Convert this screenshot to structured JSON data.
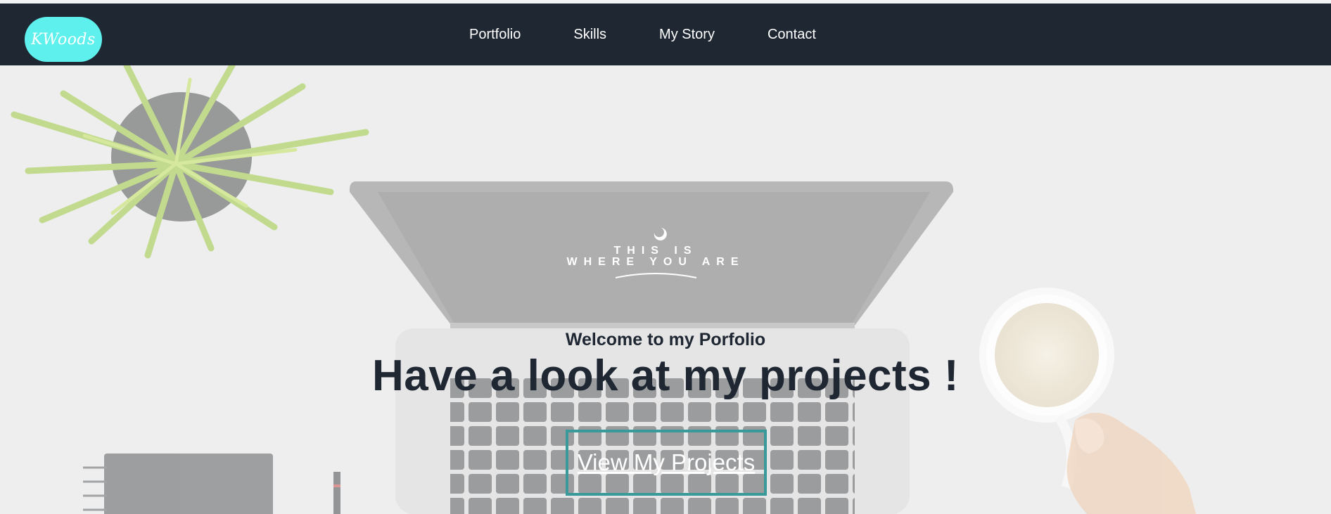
{
  "header": {
    "logo_text": "KWoods",
    "logo_color": "#5ef0ec",
    "background": "#1f2733",
    "nav": [
      {
        "label": "Portfolio"
      },
      {
        "label": "Skills"
      },
      {
        "label": "My Story"
      },
      {
        "label": "Contact"
      }
    ]
  },
  "hero": {
    "screen_line_1": "THIS IS",
    "screen_line_2": "WHERE YOU ARE",
    "welcome": "Welcome to my Porfolio",
    "headline": "Have a look at my projects !",
    "cta_label": "View My Projects",
    "cta_border_color": "#3a9a9a"
  }
}
